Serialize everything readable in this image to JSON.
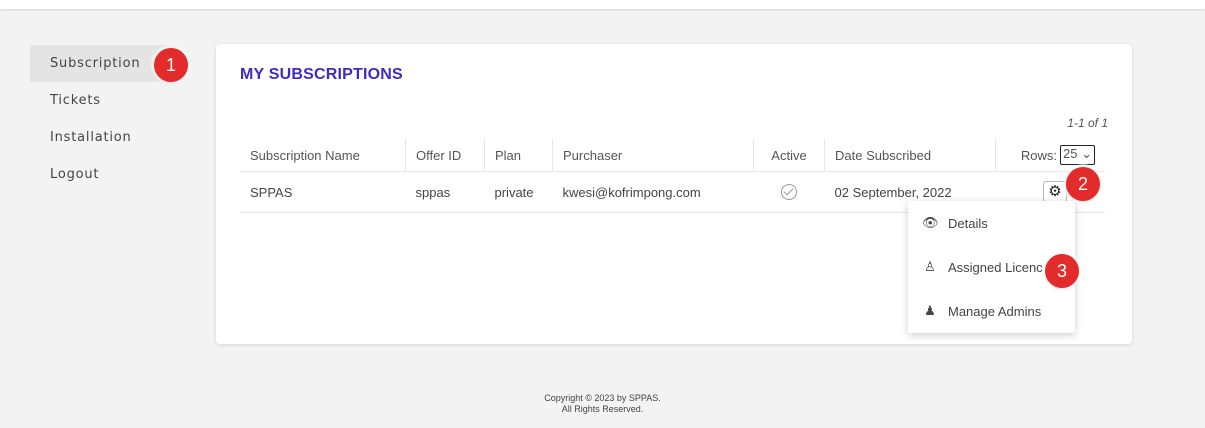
{
  "sidebar": {
    "items": [
      {
        "label": "Subscription"
      },
      {
        "label": "Tickets"
      },
      {
        "label": "Installation"
      },
      {
        "label": "Logout"
      }
    ]
  },
  "badges": {
    "one": "1",
    "two": "2",
    "three": "3"
  },
  "main": {
    "title": "MY SUBSCRIPTIONS",
    "pager": "1-1 of 1",
    "rows_label": "Rows:",
    "rows_value": "25",
    "columns": [
      "Subscription Name",
      "Offer ID",
      "Plan",
      "Purchaser",
      "Active",
      "Date Subscribed"
    ],
    "row": {
      "name": "SPPAS",
      "offer_id": "sppas",
      "plan": "private",
      "purchaser": "kwesi@kofrimpong.com",
      "active_icon": "check-circle-icon",
      "date": "02 September, 2022"
    }
  },
  "menu": {
    "items": [
      {
        "label": "Details",
        "icon": "eye-icon"
      },
      {
        "label": "Assigned Licenc",
        "icon": "user-license-icon"
      },
      {
        "label": "Manage Admins",
        "icon": "admin-users-icon"
      }
    ]
  },
  "footer": {
    "line1": "Copyright © 2023 by SPPAS.",
    "line2": "All Rights Reserved."
  },
  "colors": {
    "accent": "#3d2bc6",
    "badge": "#e32b2b"
  }
}
